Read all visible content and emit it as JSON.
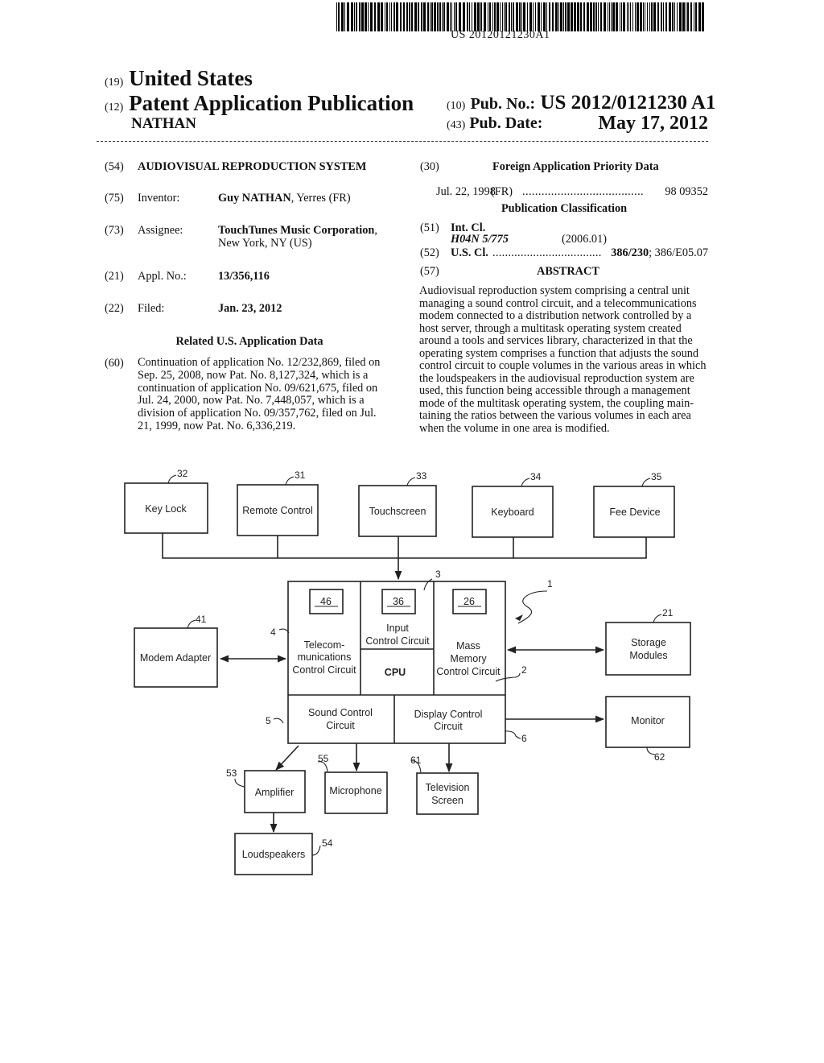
{
  "header": {
    "barcode_number": "US 20120121230A1",
    "country_tag": "(19)",
    "country": "United States",
    "doc_type_tag": "(12)",
    "doc_type": "Patent Application Publication",
    "inventor_surname": "NATHAN",
    "pub_no_tag": "(10)",
    "pub_no_label": "Pub. No.:",
    "pub_no": "US 2012/0121230 A1",
    "pub_date_tag": "(43)",
    "pub_date_label": "Pub. Date:",
    "pub_date": "May 17, 2012"
  },
  "left_column": {
    "title": {
      "tag": "(54)",
      "value": "AUDIOVISUAL REPRODUCTION SYSTEM"
    },
    "inventor": {
      "tag": "(75)",
      "label": "Inventor:",
      "name": "Guy NATHAN",
      "location": ", Yerres (FR)"
    },
    "assignee": {
      "tag": "(73)",
      "label": "Assignee:",
      "name": "TouchTunes Music Corporation",
      "name_suffix": ",",
      "location": "New York, NY (US)"
    },
    "appl_no": {
      "tag": "(21)",
      "label": "Appl. No.:",
      "value": "13/356,116"
    },
    "filed": {
      "tag": "(22)",
      "label": "Filed:",
      "value": "Jan. 23, 2012"
    },
    "related_heading": "Related U.S. Application Data",
    "related": {
      "tag": "(60)",
      "lines": [
        "Continuation of application No. 12/232,869, filed on",
        "Sep. 25, 2008, now Pat. No. 8,127,324, which is a",
        "continuation of application No. 09/621,675, filed on",
        "Jul. 24, 2000, now Pat. No. 7,448,057, which is a",
        "division of application No. 09/357,762, filed on Jul.",
        "21, 1999, now Pat. No. 6,336,219."
      ]
    }
  },
  "right_column": {
    "foreign": {
      "tag": "(30)",
      "heading": "Foreign Application Priority Data",
      "date": "Jul. 22, 1998",
      "country": "(FR)",
      "dots": "......................................",
      "number": "98 09352"
    },
    "classification_heading": "Publication Classification",
    "int_cl": {
      "tag": "(51)",
      "label": "Int. Cl.",
      "code": "H04N 5/775",
      "version": "(2006.01)"
    },
    "us_cl": {
      "tag": "(52)",
      "label": "U.S. Cl.",
      "dots": "...................................",
      "primary": "386/230",
      "secondary": "; 386/E05.07"
    },
    "abstract_tag": "(57)",
    "abstract_heading": "ABSTRACT",
    "abstract_lines": [
      "Audiovisual reproduction system comprising a central unit",
      "managing a sound control circuit, and a telecommunications",
      "modem connected to a distribution network controlled by a",
      "host server, through a multitask operating system created",
      "around a tools and services library, characterized in that the",
      "operating system comprises a function that adjusts the sound",
      "control circuit to couple volumes in the various areas in which",
      "the loudspeakers in the audiovisual reproduction system are",
      "used, this function being accessible through a management",
      "mode of the multitask operating system, the coupling main-",
      "taining the ratios between the various volumes in each area",
      "when the volume in one area is modified."
    ]
  },
  "diagram": {
    "top_boxes": [
      {
        "ref": "32",
        "label": "Key Lock"
      },
      {
        "ref": "31",
        "label": "Remote Control"
      },
      {
        "ref": "33",
        "label": "Touchscreen"
      },
      {
        "ref": "34",
        "label": "Keyboard"
      },
      {
        "ref": "35",
        "label": "Fee Device"
      }
    ],
    "central_ref": "1",
    "ref_3": "3",
    "ref_4": "4",
    "ref_2": "2",
    "ref_5": "5",
    "ref_6": "6",
    "telecom": {
      "sub_ref": "46",
      "lines": [
        "Telecom-",
        "munications",
        "Control Circuit"
      ]
    },
    "input": {
      "sub_ref": "36",
      "lines": [
        "Input",
        "Control Circuit"
      ]
    },
    "cpu": "CPU",
    "mass": {
      "sub_ref": "26",
      "lines": [
        "Mass",
        "Memory",
        "Control Circuit"
      ]
    },
    "sound": [
      "Sound Control",
      "Circuit"
    ],
    "display": [
      "Display Control",
      "Circuit"
    ],
    "modem": {
      "ref": "41",
      "label": "Modem Adapter"
    },
    "storage": {
      "ref": "21",
      "lines": [
        "Storage",
        "Modules"
      ]
    },
    "monitor": {
      "ref": "62",
      "label": "Monitor"
    },
    "amplifier": {
      "ref": "53",
      "label": "Amplifier"
    },
    "microphone": {
      "ref": "55",
      "label": "Microphone"
    },
    "television": {
      "ref": "61",
      "lines": [
        "Television",
        "Screen"
      ]
    },
    "loudspeakers": {
      "ref": "54",
      "label": "Loudspeakers"
    }
  }
}
